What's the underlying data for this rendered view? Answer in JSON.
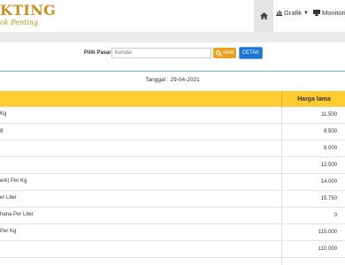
{
  "brand": {
    "title": "KTING",
    "subtitle": "ok Penting"
  },
  "nav": {
    "home_icon": "home-icon",
    "grafik_label": "Grafik",
    "monitoring_label": "Monitori"
  },
  "filter": {
    "label": "Pilih Pasar",
    "selected": "Kendal",
    "view_label": "view",
    "cetak_label": "CETAK"
  },
  "report": {
    "tanggal": "Tanggal : 29-04-2021",
    "column_price_header": "Harga lama",
    "rows": [
      {
        "name": "Kg",
        "price": "11.500"
      },
      {
        "name": "g",
        "price": "9.500"
      },
      {
        "name": "",
        "price": "8.000"
      },
      {
        "name": "",
        "price": "12.500"
      },
      {
        "name": "erk) Per Kg",
        "price": "14.000"
      },
      {
        "name": "er Liter",
        "price": "15.750"
      },
      {
        "name": "hana Per Liter",
        "price": "0"
      },
      {
        "name": "Per Kg",
        "price": "115.000"
      },
      {
        "name": "",
        "price": "110.000"
      },
      {
        "name": "",
        "price": ""
      }
    ]
  },
  "colors": {
    "brand": "#c8901a",
    "header": "#ffcc33",
    "view": "#f0a020",
    "cetak": "#1a73d9"
  }
}
